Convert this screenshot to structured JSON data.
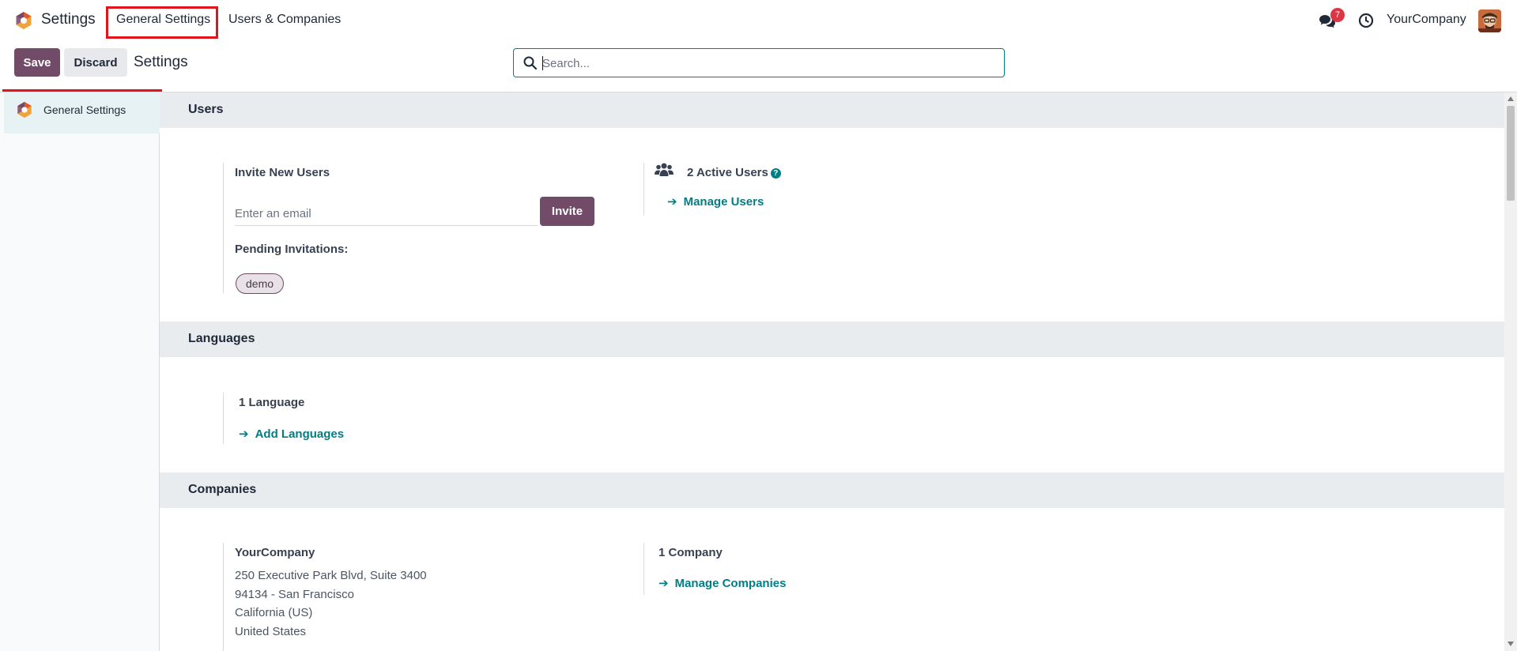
{
  "navbar": {
    "app_title": "Settings",
    "menu": [
      {
        "label": "General Settings"
      },
      {
        "label": "Users & Companies"
      }
    ],
    "notification_count": "7",
    "company": "YourCompany"
  },
  "control_panel": {
    "save_label": "Save",
    "discard_label": "Discard",
    "title": "Settings",
    "search_placeholder": "Search..."
  },
  "sidebar": {
    "items": [
      {
        "label": "General Settings"
      }
    ]
  },
  "sections": {
    "users": {
      "title": "Users",
      "invite_label": "Invite New Users",
      "email_placeholder": "Enter an email",
      "invite_button": "Invite",
      "pending_label": "Pending Invitations:",
      "pending_tags": [
        "demo"
      ],
      "active_users": "2 Active Users",
      "manage_users": "Manage Users"
    },
    "languages": {
      "title": "Languages",
      "count": "1 Language",
      "add_languages": "Add Languages"
    },
    "companies": {
      "title": "Companies",
      "company_name": "YourCompany",
      "address_lines": [
        "250 Executive Park Blvd, Suite 3400",
        "94134 - San Francisco",
        "California (US)",
        "United States"
      ],
      "count": "1 Company",
      "manage_companies": "Manage Companies"
    }
  },
  "colors": {
    "brand": "#714b67",
    "link": "#017e84",
    "highlight": "#e3131b"
  }
}
